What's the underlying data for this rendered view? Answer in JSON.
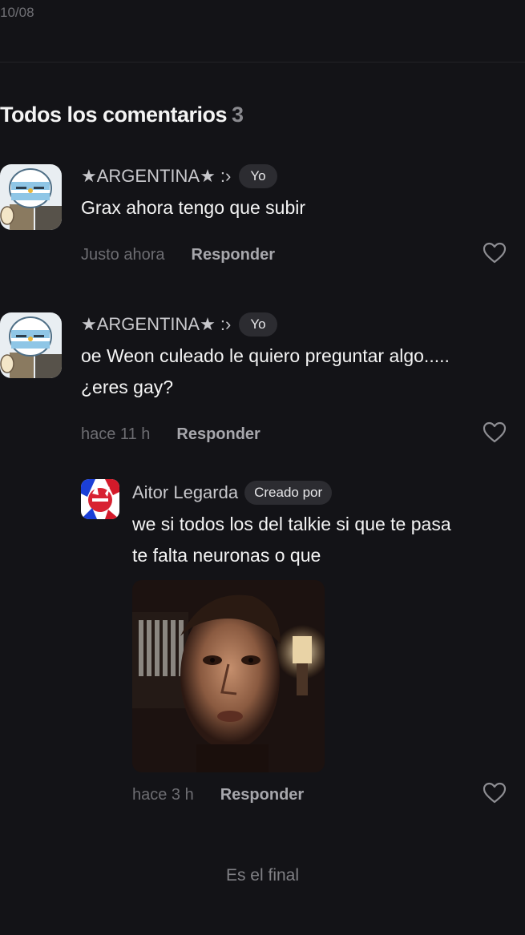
{
  "header": {
    "date": "10/08"
  },
  "comments_section": {
    "title": "Todos los comentarios",
    "count": "3"
  },
  "comments": [
    {
      "author": "★ARGENTINA★ :›",
      "badge": "Yo",
      "text_lines": [
        "Grax ahora tengo que subir"
      ],
      "time": "Justo ahora",
      "reply_label": "Responder"
    },
    {
      "author": "★ARGENTINA★ :›",
      "badge": "Yo",
      "text_lines": [
        "oe Weon culeado  le quiero preguntar algo.....",
        "¿eres gay?"
      ],
      "time": "hace 11 h",
      "reply_label": "Responder"
    },
    {
      "author": "Aitor Legarda",
      "badge": "Creado por",
      "text_lines": [
        "we si todos los del talkie si que te pasa",
        "te falta neuronas o que"
      ],
      "time": "hace 3 h",
      "reply_label": "Responder"
    }
  ],
  "footer": {
    "end_label": "Es el final"
  },
  "icons": {
    "like": "heart-outline-icon"
  },
  "colors": {
    "background": "#131317",
    "badge_bg": "#2c2c31",
    "muted_text": "#6d6d72"
  }
}
